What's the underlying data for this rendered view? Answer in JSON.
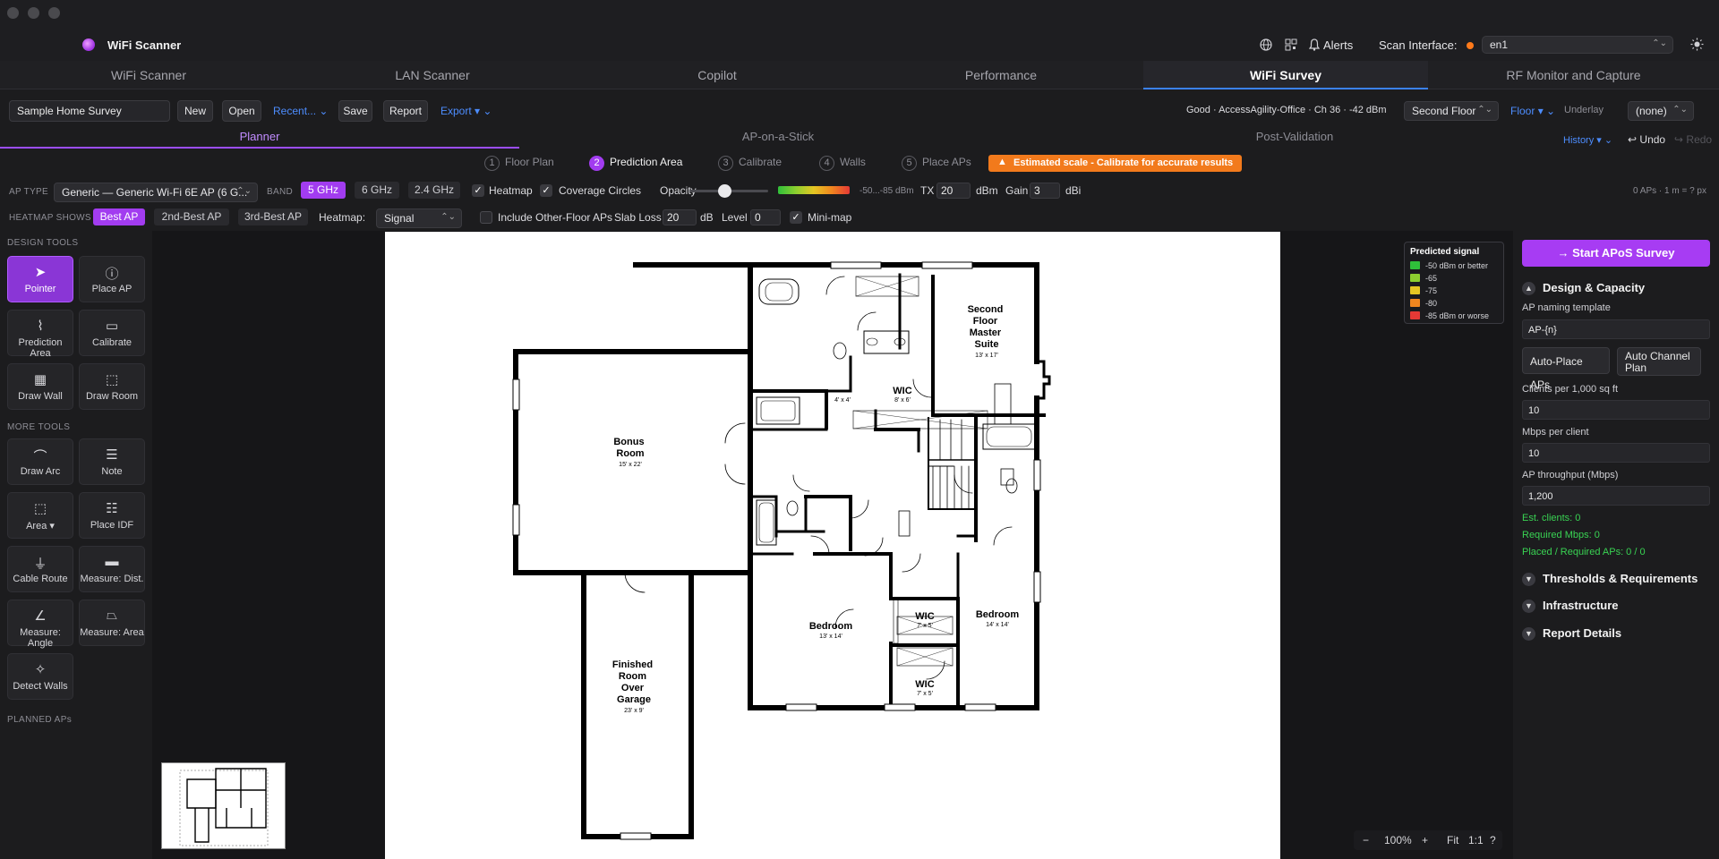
{
  "app": {
    "title": "WiFi Scanner",
    "alerts_label": "Alerts",
    "scan_interface_label": "Scan Interface:",
    "scan_interface_value": "en1"
  },
  "main_tabs": [
    "WiFi Scanner",
    "LAN Scanner",
    "Copilot",
    "Performance",
    "WiFi Survey",
    "RF Monitor and Capture"
  ],
  "toolbar": {
    "survey_name": "Sample Home Survey",
    "new_label": "New",
    "open_label": "Open",
    "recent_label": "Recent...",
    "save_label": "Save",
    "report_label": "Report",
    "export_label": "Export",
    "status_text": "Good · AccessAgility-Office · Ch 36 · -42 dBm",
    "floor_select": "Second Floor",
    "floor_link": "Floor",
    "underlay_label": "Underlay",
    "underlay_select": "(none)"
  },
  "sub_tabs": [
    "Planner",
    "AP-on-a-Stick",
    "Post-Validation"
  ],
  "history": {
    "history_label": "History",
    "undo_label": "Undo",
    "redo_label": "Redo"
  },
  "steps": [
    {
      "num": "1",
      "label": "Floor Plan"
    },
    {
      "num": "2",
      "label": "Prediction Area"
    },
    {
      "num": "3",
      "label": "Calibrate"
    },
    {
      "num": "4",
      "label": "Walls"
    },
    {
      "num": "5",
      "label": "Place APs"
    }
  ],
  "warning": "Estimated scale - Calibrate for accurate results",
  "options_row1": {
    "ap_type_label": "AP TYPE",
    "ap_type_value": "Generic — Generic Wi-Fi 6E AP (6 G...",
    "band_label": "BAND",
    "bands": [
      "5 GHz",
      "6 GHz",
      "2.4 GHz"
    ],
    "heatmap_label": "Heatmap",
    "coverage_label": "Coverage Circles",
    "opacity_label": "Opacity",
    "range_text": "-50...-85 dBm",
    "tx_label": "TX",
    "tx_value": "20",
    "tx_unit": "dBm",
    "gain_label": "Gain",
    "gain_value": "3",
    "gain_unit": "dBi",
    "ap_summary": "0 APs · 1 m = ? px"
  },
  "options_row2": {
    "heatmap_shows_label": "HEATMAP SHOWS",
    "best_options": [
      "Best AP",
      "2nd-Best AP",
      "3rd-Best AP"
    ],
    "heatmap_label": "Heatmap:",
    "heatmap_value": "Signal",
    "other_floor_label": "Include Other-Floor APs",
    "slab_label": "Slab Loss",
    "slab_value": "20",
    "slab_unit": "dB",
    "level_label": "Level",
    "level_value": "0",
    "minimap_label": "Mini-map"
  },
  "left_panel": {
    "design_tools_title": "DESIGN TOOLS",
    "design_tools": [
      "Pointer",
      "Place AP",
      "Prediction Area",
      "Calibrate",
      "Draw Wall",
      "Draw Room"
    ],
    "more_tools_title": "MORE TOOLS",
    "more_tools": [
      "Draw Arc",
      "Note",
      "Area",
      "Place IDF",
      "Cable Route",
      "Measure: Dist.",
      "Measure: Angle",
      "Measure: Area",
      "Detect Walls"
    ],
    "planned_title": "PLANNED APs"
  },
  "floor_plan": {
    "rooms": [
      {
        "name": [
          "Second",
          "Floor",
          "Master",
          "Suite"
        ],
        "dim": "13' x 17'"
      },
      {
        "name": [
          "WIC"
        ],
        "dim": "8' x 6'"
      },
      {
        "name": [
          "Bonus",
          "Room"
        ],
        "dim": "15' x 22'"
      },
      {
        "name": [
          "Bedroom"
        ],
        "dim": "13' x 14'"
      },
      {
        "name": [
          "Bedroom"
        ],
        "dim": "14' x 14'"
      },
      {
        "name": [
          "WIC"
        ],
        "dim": "7' x 5'"
      },
      {
        "name": [
          "WIC"
        ],
        "dim": "7' x 5'"
      },
      {
        "name": [
          "Finished",
          "Room",
          "Over",
          "Garage"
        ],
        "dim": "23' x 9'"
      }
    ],
    "small_dim": "4' x 4'"
  },
  "legend": {
    "title": "Predicted signal",
    "items": [
      {
        "label": "-50 dBm or better",
        "color": "#2fbf3a"
      },
      {
        "label": "-65",
        "color": "#8ccf2f"
      },
      {
        "label": "-75",
        "color": "#e5c623"
      },
      {
        "label": "-80",
        "color": "#f0861f"
      },
      {
        "label": "-85 dBm or worse",
        "color": "#e53935"
      }
    ]
  },
  "zoom": {
    "minus": "−",
    "level": "100%",
    "plus": "+",
    "fit": "Fit",
    "one": "1:1",
    "help": "?"
  },
  "right_panel": {
    "start_label": "→ Start APoS Survey",
    "design_section": "Design & Capacity",
    "naming_label": "AP naming template",
    "naming_value": "AP-{n}",
    "auto_place_label": "Auto-Place APs",
    "auto_channel_label": "Auto Channel Plan",
    "clients_label": "Clients per 1,000 sq ft",
    "clients_value": "10",
    "mbps_label": "Mbps per client",
    "mbps_value": "10",
    "throughput_label": "AP throughput (Mbps)",
    "throughput_value": "1,200",
    "est_clients": "Est. clients: 0",
    "req_mbps": "Required Mbps: 0",
    "placed": "Placed / Required APs: 0 / 0",
    "sections": [
      "Thresholds & Requirements",
      "Infrastructure",
      "Report Details"
    ]
  }
}
